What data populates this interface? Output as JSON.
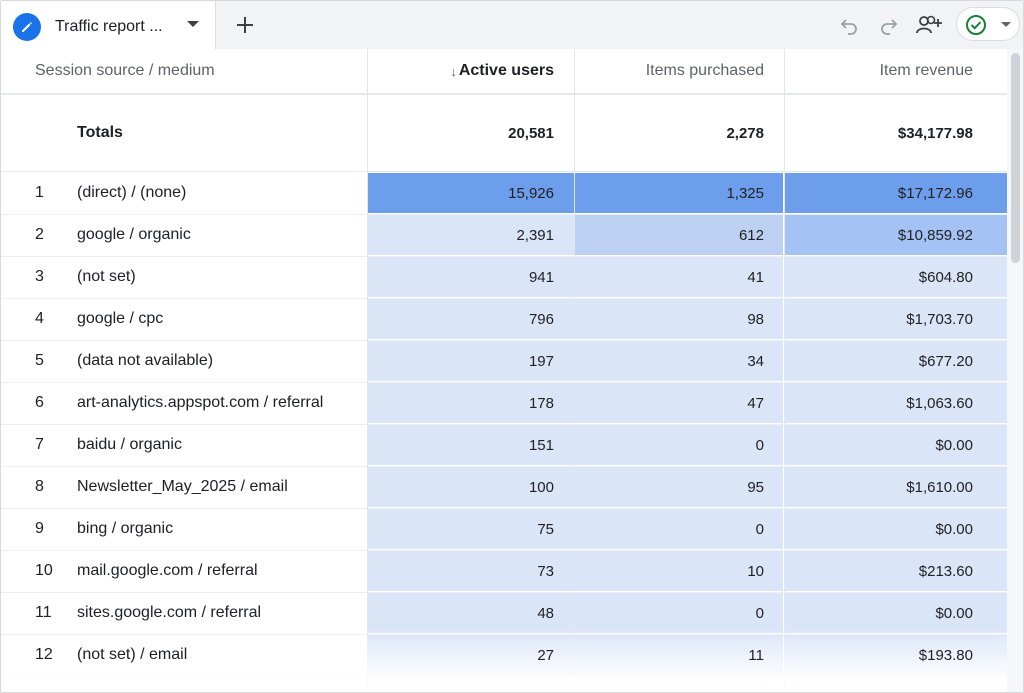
{
  "tab": {
    "title": "Traffic report ..."
  },
  "colors": {
    "accent": "#1a73e8",
    "heat_strong": "#6d9eeb",
    "heat_mid": "#a4c2f4",
    "heat_light": "#dbe5f8",
    "heat_medium_light": "#bcd0f2",
    "status_green": "#188038"
  },
  "toolbar": {
    "undo_icon": "undo-icon",
    "redo_icon": "redo-icon",
    "share_icon": "add-user-icon",
    "status_icon": "check-circle-icon"
  },
  "table": {
    "headers": {
      "source": "Session source / medium",
      "sort_arrow": "↓",
      "active_users": "Active users",
      "items_purchased": "Items purchased",
      "item_revenue": "Item revenue"
    },
    "totals": {
      "label": "Totals",
      "active_users": "20,581",
      "items_purchased": "2,278",
      "item_revenue": "$34,177.98"
    },
    "rows": [
      {
        "idx": "1",
        "source": "(direct) / (none)",
        "active_users": "15,926",
        "items_purchased": "1,325",
        "item_revenue": "$17,172.96"
      },
      {
        "idx": "2",
        "source": "google / organic",
        "active_users": "2,391",
        "items_purchased": "612",
        "item_revenue": "$10,859.92"
      },
      {
        "idx": "3",
        "source": "(not set)",
        "active_users": "941",
        "items_purchased": "41",
        "item_revenue": "$604.80"
      },
      {
        "idx": "4",
        "source": "google / cpc",
        "active_users": "796",
        "items_purchased": "98",
        "item_revenue": "$1,703.70"
      },
      {
        "idx": "5",
        "source": "(data not available)",
        "active_users": "197",
        "items_purchased": "34",
        "item_revenue": "$677.20"
      },
      {
        "idx": "6",
        "source": "art-analytics.appspot.com / referral",
        "active_users": "178",
        "items_purchased": "47",
        "item_revenue": "$1,063.60"
      },
      {
        "idx": "7",
        "source": "baidu / organic",
        "active_users": "151",
        "items_purchased": "0",
        "item_revenue": "$0.00"
      },
      {
        "idx": "8",
        "source": "Newsletter_May_2025 / email",
        "active_users": "100",
        "items_purchased": "95",
        "item_revenue": "$1,610.00"
      },
      {
        "idx": "9",
        "source": "bing / organic",
        "active_users": "75",
        "items_purchased": "0",
        "item_revenue": "$0.00"
      },
      {
        "idx": "10",
        "source": "mail.google.com / referral",
        "active_users": "73",
        "items_purchased": "10",
        "item_revenue": "$213.60"
      },
      {
        "idx": "11",
        "source": "sites.google.com / referral",
        "active_users": "48",
        "items_purchased": "0",
        "item_revenue": "$0.00"
      },
      {
        "idx": "12",
        "source": "(not set) / email",
        "active_users": "27",
        "items_purchased": "11",
        "item_revenue": "$193.80"
      }
    ]
  }
}
